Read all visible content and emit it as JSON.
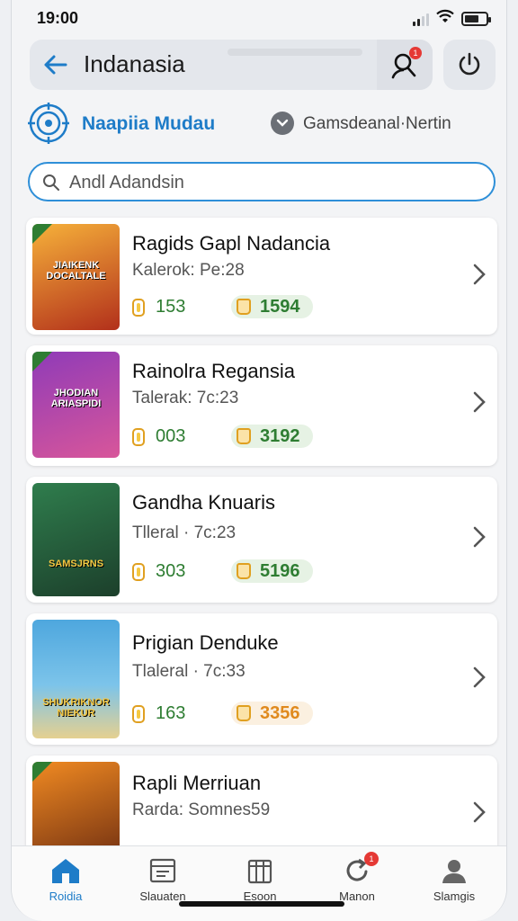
{
  "status": {
    "time": "19:00"
  },
  "header": {
    "title": "Indanasia",
    "notif_count": "1"
  },
  "filters": {
    "primary": "Naapiia Mudau",
    "secondary": "Gamsdeanal·Nertin"
  },
  "search": {
    "placeholder": "Andl Adandsin"
  },
  "cards": [
    {
      "name": "Ragids Gapl Nadancia",
      "sub": "Kalerok: Pe:28",
      "stat1": "153",
      "stat2": "1594",
      "stat2_color": "green",
      "cover_caption": "JIAIKENK DOCALTALE",
      "cover_colors": [
        "#f6b13a",
        "#b2301b"
      ]
    },
    {
      "name": "Rainolra Regansia",
      "sub": "Talerak: 7c:23",
      "stat1": "003",
      "stat2": "3192",
      "stat2_color": "green",
      "cover_caption": "JHODIAN ARIASPIDI",
      "cover_colors": [
        "#8f3bb8",
        "#d8569a"
      ]
    },
    {
      "name": "Gandha Knuaris",
      "sub": "Tlleral · 7c:23",
      "stat1": "303",
      "stat2": "5196",
      "stat2_color": "green",
      "cover_caption": "SAMSJRNS",
      "cover_colors": [
        "#2f7d4d",
        "#1c3f2b"
      ]
    },
    {
      "name": "Prigian Denduke",
      "sub": "Tlaleral · 7c:33",
      "stat1": "163",
      "stat2": "3356",
      "stat2_color": "orange",
      "cover_caption": "SHUKRIKNOR NIEKUR",
      "cover_colors": [
        "#4ea7de",
        "#e5d090"
      ]
    },
    {
      "name": "Rapli Merriuan",
      "sub": "Rarda: Somnes59",
      "stat1": "",
      "stat2": "",
      "stat2_color": "green",
      "cover_caption": "",
      "cover_colors": [
        "#f08a22",
        "#6a2a10"
      ]
    }
  ],
  "tabs": [
    {
      "label": "Roidia",
      "icon": "home-icon"
    },
    {
      "label": "Slauaten",
      "icon": "window-icon"
    },
    {
      "label": "Esoon",
      "icon": "columns-icon"
    },
    {
      "label": "Manon",
      "icon": "refresh-icon",
      "badge": "1"
    },
    {
      "label": "Slamgis",
      "icon": "person-icon"
    }
  ],
  "colors": {
    "accent": "#1e7cc8",
    "green": "#2e7d32",
    "orange": "#e08a1e"
  }
}
